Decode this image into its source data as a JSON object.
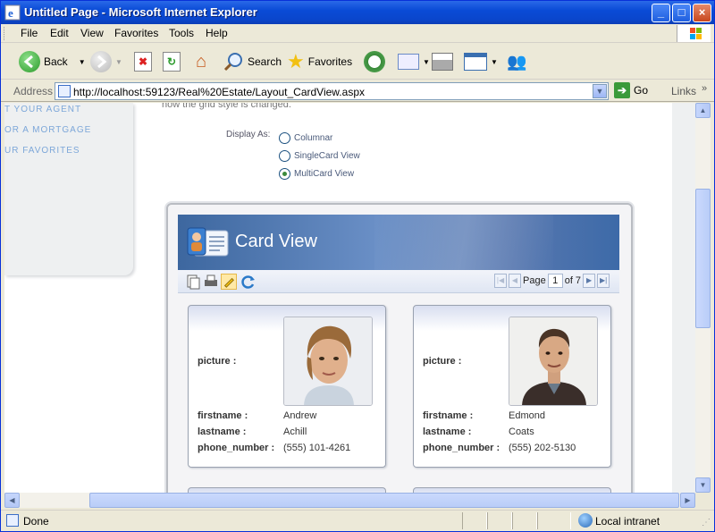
{
  "window": {
    "title": "Untitled Page - Microsoft Internet Explorer",
    "btn_min": "_",
    "btn_max": "□",
    "btn_close": "×"
  },
  "menu": {
    "items": [
      "File",
      "Edit",
      "View",
      "Favorites",
      "Tools",
      "Help"
    ]
  },
  "toolbar": {
    "back": "Back",
    "search": "Search",
    "favorites": "Favorites"
  },
  "address": {
    "label": "Address",
    "url": "http://localhost:59123/Real%20Estate/Layout_CardView.aspx",
    "go": "Go",
    "links": "Links"
  },
  "page": {
    "left_nav": [
      "T YOUR AGENT",
      "OR A MORTGAGE",
      "UR FAVORITES"
    ],
    "intro_fragment": "how the grid style is changed.",
    "display_as_label": "Display As:",
    "options": [
      {
        "label": "Columnar",
        "selected": false
      },
      {
        "label": "SingleCard View",
        "selected": false
      },
      {
        "label": "MultiCard View",
        "selected": true
      }
    ]
  },
  "cardview": {
    "title": "Card View",
    "pager": {
      "page_label": "Page",
      "page": "1",
      "of_label": "of 7"
    },
    "field_labels": {
      "picture": "picture :",
      "firstname": "firstname :",
      "lastname": "lastname :",
      "phone_number": "phone_number :"
    },
    "cards": [
      {
        "firstname": "Andrew",
        "lastname": "Achill",
        "phone_number": "(555) 101-4261"
      },
      {
        "firstname": "Edmond",
        "lastname": "Coats",
        "phone_number": "(555) 202-5130"
      }
    ]
  },
  "status": {
    "text": "Done",
    "zone": "Local intranet"
  },
  "colors": {
    "title_bar": "#0a4bd6",
    "card_header": "#4f74ad",
    "link": "#7da7d9"
  }
}
